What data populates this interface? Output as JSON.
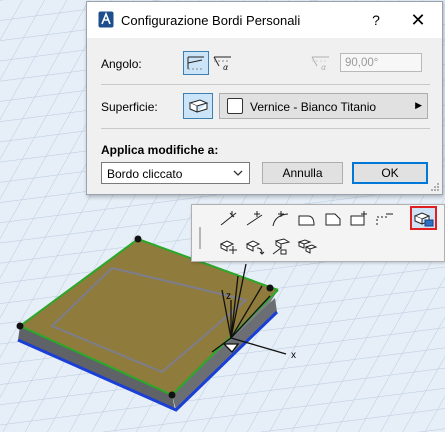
{
  "dialog": {
    "title": "Configurazione Bordi Personali",
    "help_label": "?",
    "close_label": "✕",
    "angle_label": "Angolo:",
    "angle_value": "90,00°",
    "surface_label": "Superficie:",
    "surface_value": "Vernice - Bianco Titanio",
    "apply_label": "Applica modifiche a:",
    "apply_value": "Bordo cliccato",
    "cancel_label": "Annulla",
    "ok_label": "OK"
  },
  "axes": {
    "x_label": "x",
    "z_label": "z"
  },
  "icons": {
    "title": "archicad-app-icon",
    "angle_perpendicular": "edge-perpendicular-icon",
    "angle_custom": "edge-custom-angle-icon",
    "angle_custom_disabled": "edge-angle-disabled-icon",
    "surface": "edge-surface-icon",
    "toolbar_selected": "custom-edge-settings-icon"
  },
  "colors": {
    "accent": "#0078d7",
    "selected_highlight": "#e02020",
    "slab_top": "#8c7a3f",
    "slab_edge_green": "#2aa82a",
    "slab_edge_blue": "#1a3fd6"
  }
}
